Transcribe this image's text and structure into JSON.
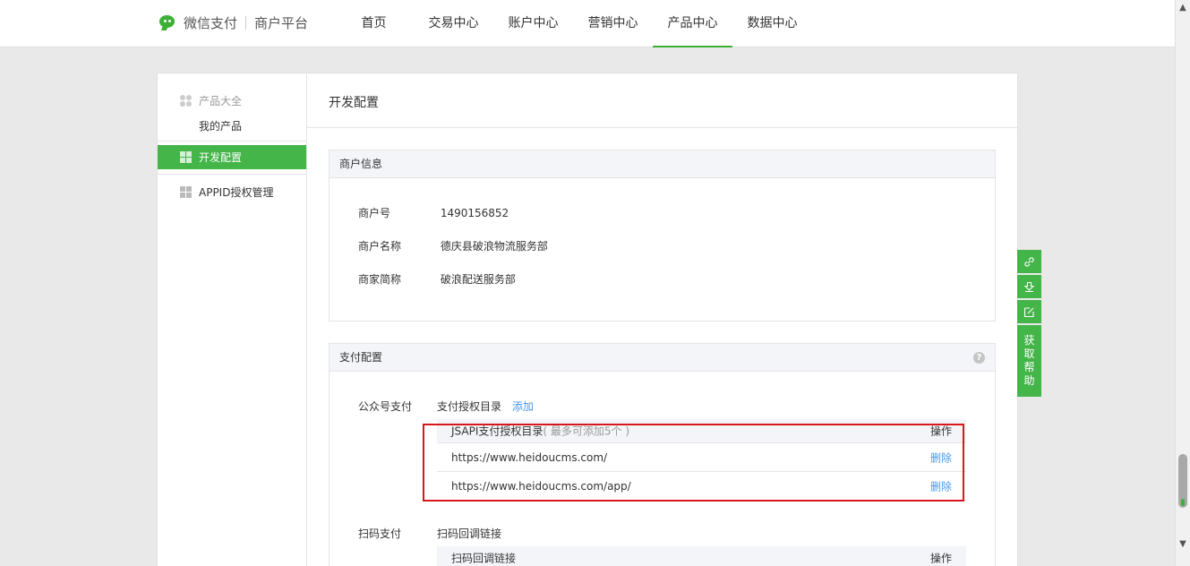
{
  "header": {
    "brand_name": "微信支付",
    "brand_sub": "商户平台",
    "nav": [
      {
        "label": "首页"
      },
      {
        "label": "交易中心"
      },
      {
        "label": "账户中心"
      },
      {
        "label": "营销中心"
      },
      {
        "label": "产品中心",
        "active": true
      },
      {
        "label": "数据中心"
      }
    ]
  },
  "sidebar": {
    "group_label": "产品大全",
    "sub_item": "我的产品",
    "active_item": "开发配置",
    "item": "APPID授权管理"
  },
  "main": {
    "title": "开发配置",
    "merchant_info": {
      "heading": "商户信息",
      "rows": [
        {
          "key": "商户号",
          "value": "1490156852"
        },
        {
          "key": "商户名称",
          "value": "德庆县破浪物流服务部"
        },
        {
          "key": "商家简称",
          "value": "破浪配送服务部"
        }
      ]
    },
    "pay_config": {
      "heading": "支付配置",
      "help_glyph": "?",
      "jsapi": {
        "label": "公众号支付",
        "section_label": "支付授权目录",
        "add_link": "添加",
        "table_head": "JSAPI支付授权目录",
        "table_hint": "( 最多可添加5个 )",
        "action_head": "操作",
        "rows": [
          {
            "url": "https://www.heidoucms.com/",
            "action": "删除"
          },
          {
            "url": "https://www.heidoucms.com/app/",
            "action": "删除"
          }
        ]
      },
      "native": {
        "label": "扫码支付",
        "section_label": "扫码回调链接",
        "table_head": "扫码回调链接",
        "action_head": "操作"
      }
    }
  },
  "floating_tools": {
    "help_chars": [
      "获",
      "取",
      "帮",
      "助"
    ]
  },
  "colors": {
    "accent": "#44b549",
    "link": "#459ae9",
    "highlight_box": "#d9161c"
  }
}
